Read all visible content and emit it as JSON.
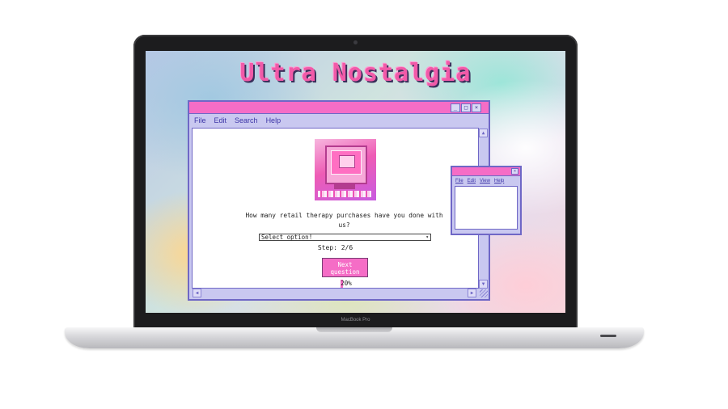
{
  "app": {
    "title": "Ultra Nostalgia"
  },
  "laptop": {
    "model": "MacBook Pro"
  },
  "main_window": {
    "controls": {
      "minimize": "_",
      "maximize": "□",
      "close": "×"
    },
    "menu": [
      "File",
      "Edit",
      "Search",
      "Help"
    ],
    "question": "How many retail therapy purchases have you done with us?",
    "select": {
      "value": "Select option!",
      "caret": "▾"
    },
    "step": "Step: 2/6",
    "next_button": "Next question",
    "progress": {
      "text": "20%",
      "value": 0.2
    },
    "scroll": {
      "up": "▲",
      "down": "▼",
      "left": "◀",
      "right": "▶"
    }
  },
  "small_window": {
    "controls": {
      "close": "×"
    },
    "menu": [
      "File",
      "Edit",
      "View",
      "Help"
    ]
  },
  "colors": {
    "titlebar": "#f56dc6",
    "window_frame": "#c9c8f0",
    "window_border": "#6f67c6",
    "title_text": "#f15aa8",
    "menu_text": "#3e36a8"
  },
  "icons": {
    "hero": "retro-crt-computer-icon"
  }
}
